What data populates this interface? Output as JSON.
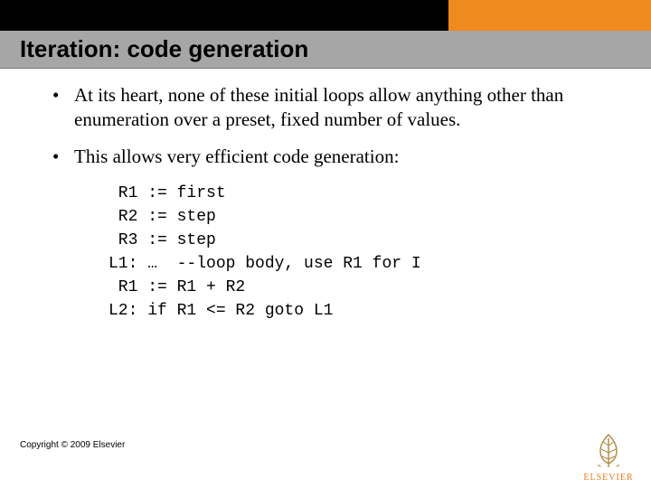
{
  "header": {
    "title": "Iteration: code generation"
  },
  "bullets": [
    "At its heart, none of these initial loops allow anything other than enumeration over a preset, fixed number of values.",
    "This allows very efficient code generation:"
  ],
  "code_lines": [
    " R1 := first",
    " R2 := step",
    " R3 := step",
    "L1: …  --loop body, use R1 for I",
    " R1 := R1 + R2",
    "L2: if R1 <= R2 goto L1"
  ],
  "footer": {
    "copyright": "Copyright © 2009 Elsevier",
    "logo_label": "ELSEVIER"
  }
}
